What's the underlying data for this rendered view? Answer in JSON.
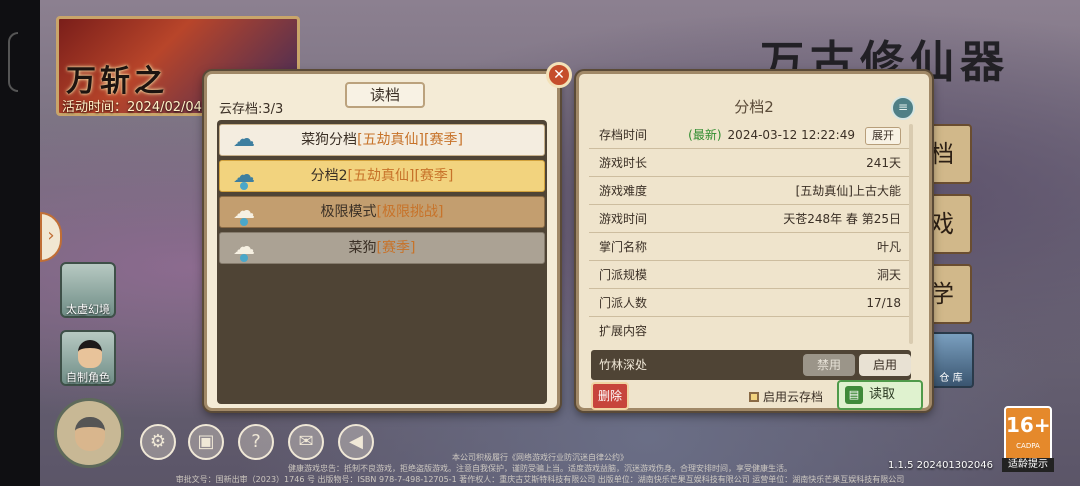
{
  "event": {
    "title": "万斩之",
    "time_label": "活动时间：2024/02/04"
  },
  "game_logo": "万古修仙器",
  "side_tiles": [
    {
      "label": "太虚幻境"
    },
    {
      "label": "自制角色"
    }
  ],
  "right_menu": {
    "btn1": "档",
    "btn2": "戏",
    "btn3": "学",
    "tile_label": "仓 库"
  },
  "save_panel": {
    "title": "读档",
    "cloud_count": "云存档:3/3",
    "slots": [
      {
        "name": "菜狗分档",
        "tag": "[五劫真仙][赛季]",
        "state": "normal"
      },
      {
        "name": "分档2",
        "tag": "[五劫真仙][赛季]",
        "state": "selected"
      },
      {
        "name": "极限模式",
        "tag": "[极限挑战]",
        "state": "dark"
      },
      {
        "name": "菜狗",
        "tag": "[赛季]",
        "state": "grey"
      }
    ]
  },
  "detail_panel": {
    "title": "分档2",
    "rows": [
      {
        "key": "存档时间",
        "new_label": "(最新)",
        "value": "2024-03-12 12:22:49",
        "expand_label": "展开"
      },
      {
        "key": "游戏时长",
        "value": "241天"
      },
      {
        "key": "游戏难度",
        "value": "[五劫真仙]上古大能"
      },
      {
        "key": "游戏时间",
        "value": "天苍248年 春 第25日"
      },
      {
        "key": "掌门名称",
        "value": "叶凡"
      },
      {
        "key": "门派规模",
        "value": "洞天"
      },
      {
        "key": "门派人数",
        "value": "17/18"
      },
      {
        "key": "扩展内容",
        "value": ""
      }
    ],
    "extension": {
      "name": "竹林深处",
      "disable_label": "禁用",
      "enable_label": "启用"
    },
    "delete_label": "删除",
    "cloud_toggle_label": "启用云存档",
    "load_label": "读取"
  },
  "age_rating": {
    "rating": "16+",
    "org": "CADPA",
    "label": "适龄提示"
  },
  "version": "1.1.5 202401302046",
  "footer": {
    "line1": "本公司积极履行《网络游戏行业防沉迷自律公约》",
    "line2": "健康游戏忠告：抵制不良游戏，拒绝盗版游戏。注意自我保护，谨防受骗上当。适度游戏益脑，沉迷游戏伤身。合理安排时间，享受健康生活。",
    "line3": "审批文号：国新出审（2023）1746 号 出版物号：ISBN 978-7-498-12705-1 著作权人：重庆古艾斯特科技有限公司 出版单位：湖南快乐芒果互娱科技有限公司 运营单位：湖南快乐芒果互娱科技有限公司"
  },
  "colors": {
    "panel_bg": "#f4ebd6",
    "selected_slot": "#f2d37e",
    "tag_orange": "#c7732a",
    "new_green": "#2e8c2e",
    "delete_red": "#c7453c",
    "load_green": "#dff2cf"
  }
}
